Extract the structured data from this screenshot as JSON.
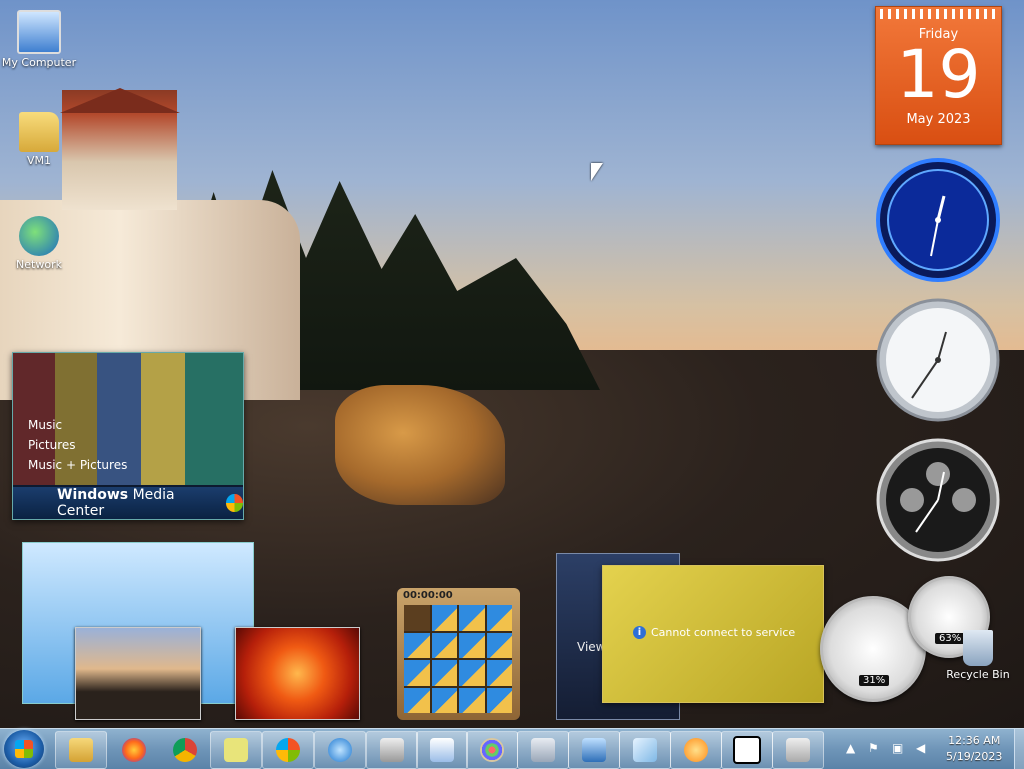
{
  "desktop_icons": [
    {
      "label": "My Computer",
      "icon": "computer-icon"
    },
    {
      "label": "VM1",
      "icon": "user-folder-icon"
    },
    {
      "label": "Network",
      "icon": "network-icon"
    },
    {
      "label": "Recycle Bin",
      "icon": "recycle-bin-icon"
    }
  ],
  "calendar": {
    "weekday": "Friday",
    "day": "19",
    "month_year": "May 2023"
  },
  "media_center": {
    "items": [
      "Music",
      "Pictures",
      "Music + Pictures"
    ],
    "brand": "Windows",
    "brand_suffix": "Media Center"
  },
  "puzzle": {
    "timer": "00:00:00"
  },
  "feed": {
    "label": "View"
  },
  "currency": {
    "message": "Cannot connect to service"
  },
  "cpu_meter": {
    "cpu": "31%",
    "ram": "63%"
  },
  "taskbar": {
    "pinned": [
      "explorer-icon",
      "firefox-icon",
      "chrome-icon",
      "sticky-notes-icon",
      "windows-update-icon",
      "internet-explorer-icon",
      "on-screen-keyboard-icon",
      "wordpad-icon",
      "paint-icon",
      "calculator-icon",
      "remote-desktop-icon",
      "snipping-tool-icon",
      "media-player-icon",
      "7zip-icon",
      "tablet-input-icon"
    ],
    "clock_time": "12:36 AM",
    "clock_date": "5/19/2023"
  },
  "colors": {
    "calendar_orange": "#e1621f",
    "taskbar_blue": "#6f95b8"
  }
}
